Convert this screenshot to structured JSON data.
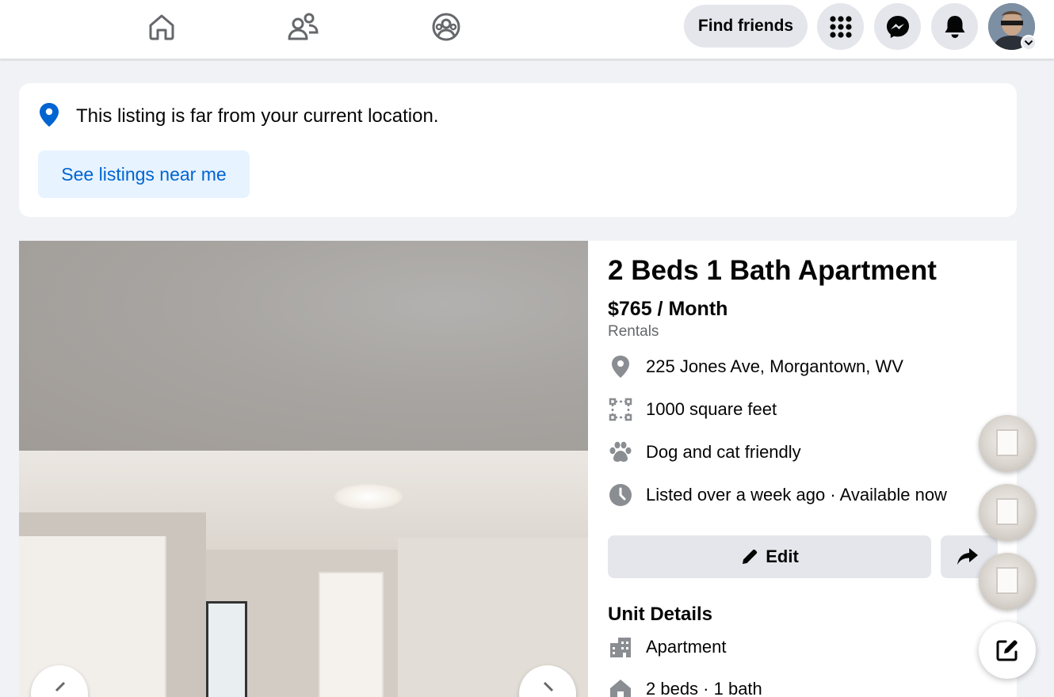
{
  "topbar": {
    "find_friends_label": "Find friends"
  },
  "notice": {
    "message": "This listing is far from your current location.",
    "button_label": "See listings near me"
  },
  "listing": {
    "title": "2 Beds 1 Bath Apartment",
    "price": "$765 / Month",
    "category": "Rentals",
    "attributes": [
      {
        "icon": "location-pin-icon",
        "text": "225 Jones Ave, Morgantown, WV"
      },
      {
        "icon": "square-feet-icon",
        "text": "1000 square feet"
      },
      {
        "icon": "paw-icon",
        "text": "Dog and cat friendly"
      },
      {
        "icon": "clock-icon",
        "text": "Listed over a week ago · Available now"
      }
    ],
    "edit_label": "Edit",
    "unit_details_heading": "Unit Details",
    "unit_details": [
      {
        "icon": "building-icon",
        "text": "Apartment"
      },
      {
        "icon": "house-icon",
        "text": "2 beds · 1 bath"
      }
    ]
  },
  "colors": {
    "accent_blue": "#0064d1",
    "light_blue_bg": "#e7f3ff",
    "button_gray": "#e4e6eb",
    "page_bg": "#f0f2f5",
    "secondary_text": "#65676b",
    "icon_gray": "#8a8d91"
  }
}
